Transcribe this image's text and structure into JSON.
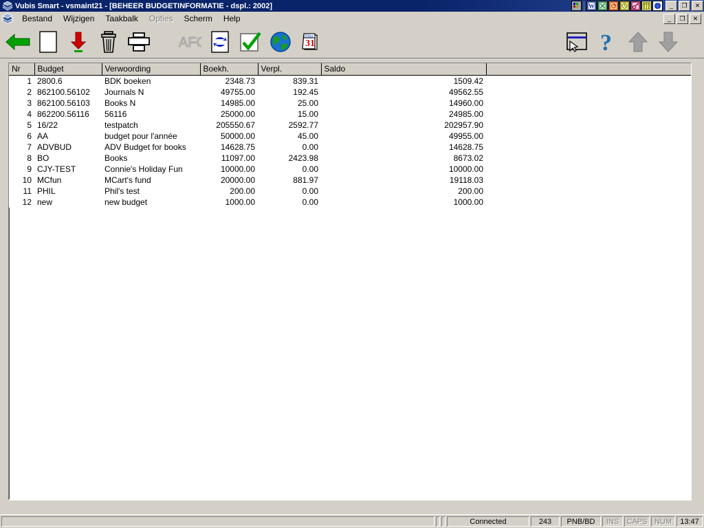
{
  "window": {
    "title": "Vubis Smart - vsmaint21 - [BEHEER BUDGETINFORMATIE - dspl.: 2002]",
    "app_icon": "books-stack-icon",
    "minimize_label": "_",
    "restore_label": "❐",
    "close_label": "✕",
    "child_minimize_label": "_",
    "child_restore_label": "❐",
    "child_close_label": "✕"
  },
  "tray": {
    "icons": [
      {
        "name": "program-group-icon",
        "color": "#808080"
      },
      {
        "name": "word-icon",
        "color": "#1f3f9f"
      },
      {
        "name": "excel-icon",
        "color": "#1a7a3a"
      },
      {
        "name": "powerpoint-icon",
        "color": "#cc4400"
      },
      {
        "name": "clock-icon",
        "color": "#8a8a00"
      },
      {
        "name": "key-icon",
        "color": "#a01050"
      },
      {
        "name": "calculator-icon",
        "color": "#9a9a10"
      },
      {
        "name": "globe-blue-icon",
        "color": "#1030b0"
      }
    ]
  },
  "menu": {
    "icon": "books-stack-icon",
    "items": [
      {
        "label": "Bestand",
        "disabled": false
      },
      {
        "label": "Wijzigen",
        "disabled": false
      },
      {
        "label": "Taakbalk",
        "disabled": false
      },
      {
        "label": "Opties",
        "disabled": true
      },
      {
        "label": "Scherm",
        "disabled": false
      },
      {
        "label": "Help",
        "disabled": false
      }
    ]
  },
  "toolbar": {
    "buttons": [
      {
        "name": "back-arrow-icon",
        "label": "Terug"
      },
      {
        "name": "new-document-icon",
        "label": "Nieuw"
      },
      {
        "name": "download-arrow-icon",
        "label": "Opslaan"
      },
      {
        "name": "trash-can-icon",
        "label": "Verwijderen"
      },
      {
        "name": "printer-icon",
        "label": "Afdrukken"
      },
      {
        "name": "afo-icon",
        "label": "AFO",
        "disabled": true
      },
      {
        "name": "refresh-icon",
        "label": "Vernieuwen"
      },
      {
        "name": "checkmark-icon",
        "label": "Bevestigen"
      },
      {
        "name": "globe-icon",
        "label": "Internet"
      },
      {
        "name": "calendar-icon",
        "label": "Kalender",
        "text_month": "May",
        "text_day": "31"
      }
    ],
    "right_buttons": [
      {
        "name": "select-window-icon",
        "label": "Selecteren"
      },
      {
        "name": "help-question-icon",
        "label": "Help"
      },
      {
        "name": "up-arrow-icon",
        "label": "Omhoog"
      },
      {
        "name": "down-arrow-icon",
        "label": "Omlaag"
      }
    ]
  },
  "grid": {
    "columns": [
      {
        "key": "nr",
        "label": "Nr"
      },
      {
        "key": "budget",
        "label": "Budget"
      },
      {
        "key": "verwoording",
        "label": "Verwoording"
      },
      {
        "key": "boekh",
        "label": "Boekh."
      },
      {
        "key": "verpl",
        "label": "Verpl."
      },
      {
        "key": "saldo",
        "label": "Saldo"
      },
      {
        "key": "extra",
        "label": ""
      }
    ],
    "rows": [
      {
        "nr": "1",
        "budget": "2800.6",
        "verwoording": "BDK boeken",
        "boekh": "2348.73",
        "verpl": "839.31",
        "saldo": "1509.42"
      },
      {
        "nr": "2",
        "budget": "862100.56102",
        "verwoording": "Journals N",
        "boekh": "49755.00",
        "verpl": "192.45",
        "saldo": "49562.55"
      },
      {
        "nr": "3",
        "budget": "862100.56103",
        "verwoording": "Books N",
        "boekh": "14985.00",
        "verpl": "25.00",
        "saldo": "14960.00"
      },
      {
        "nr": "4",
        "budget": "862200.56116",
        "verwoording": "56116",
        "boekh": "25000.00",
        "verpl": "15.00",
        "saldo": "24985.00"
      },
      {
        "nr": "5",
        "budget": "16/22",
        "verwoording": "testpatch",
        "boekh": "205550.67",
        "verpl": "2592.77",
        "saldo": "202957.90"
      },
      {
        "nr": "6",
        "budget": "AA",
        "verwoording": "budget pour l'année",
        "boekh": "50000.00",
        "verpl": "45.00",
        "saldo": "49955.00"
      },
      {
        "nr": "7",
        "budget": "ADVBUD",
        "verwoording": "ADV Budget for books",
        "boekh": "14628.75",
        "verpl": "0.00",
        "saldo": "14628.75"
      },
      {
        "nr": "8",
        "budget": "BO",
        "verwoording": "Books",
        "boekh": "11097.00",
        "verpl": "2423.98",
        "saldo": "8673.02"
      },
      {
        "nr": "9",
        "budget": "CJY-TEST",
        "verwoording": "Connie's Holiday Fun",
        "boekh": "10000.00",
        "verpl": "0.00",
        "saldo": "10000.00"
      },
      {
        "nr": "10",
        "budget": "MCfun",
        "verwoording": "MCart's fund",
        "boekh": "20000.00",
        "verpl": "881.97",
        "saldo": "19118.03"
      },
      {
        "nr": "11",
        "budget": "PHIL",
        "verwoording": "Phil's test",
        "boekh": "200.00",
        "verpl": "0.00",
        "saldo": "200.00"
      },
      {
        "nr": "12",
        "budget": "new",
        "verwoording": "new budget",
        "boekh": "1000.00",
        "verpl": "0.00",
        "saldo": "1000.00"
      }
    ]
  },
  "statusbar": {
    "message": "",
    "connection": "Connected",
    "record_count": "243",
    "database": "PNB/BD",
    "ins": "INS",
    "caps": "CAPS",
    "num": "NUM",
    "time": "13:47"
  }
}
